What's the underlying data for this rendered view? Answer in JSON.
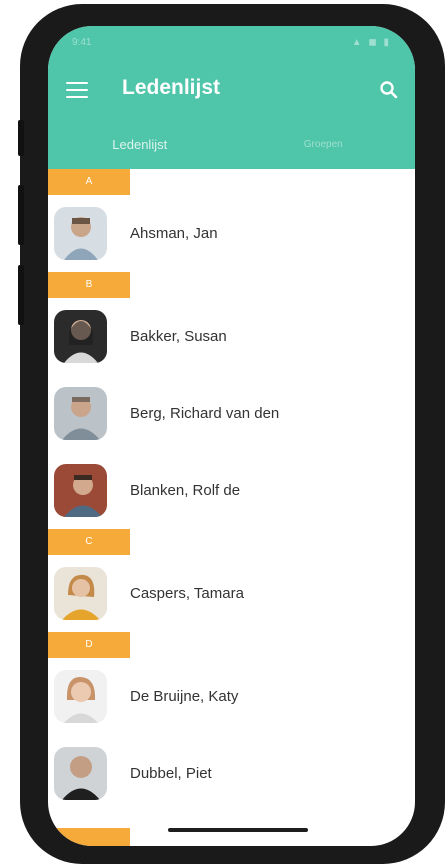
{
  "status": {
    "time": "9:41",
    "icons": "▲ ◼ ▮"
  },
  "header": {
    "title": "Ledenlijst"
  },
  "tabs": [
    {
      "label": "Ledenlijst"
    },
    {
      "label": "Groepen"
    }
  ],
  "colors": {
    "header": "#4fc5a9",
    "letter_band": "#f6aa3a"
  },
  "letters": [
    "A",
    "B",
    "C",
    "D"
  ],
  "members": [
    {
      "name": "Ahsman, Jan"
    },
    {
      "name": "Bakker, Susan"
    },
    {
      "name": "Berg, Richard van den"
    },
    {
      "name": "Blanken, Rolf de"
    },
    {
      "name": "Caspers, Tamara"
    },
    {
      "name": "De Bruijne, Katy"
    },
    {
      "name": "Dubbel, Piet"
    }
  ]
}
